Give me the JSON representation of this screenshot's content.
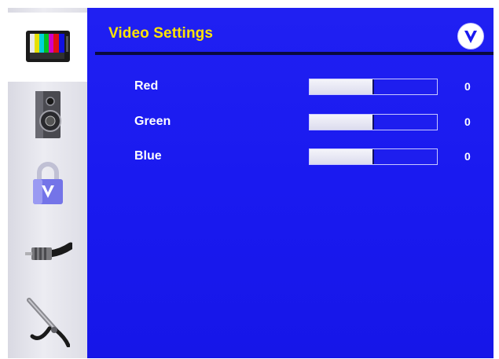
{
  "menu": {
    "title": "Video Settings",
    "accent_color": "#ffe400",
    "panel_color": "#1a1af0",
    "logo_icon": "vizio-v-logo-icon"
  },
  "sidebar": {
    "items": [
      {
        "name": "video",
        "icon": "tv-color-bars-icon",
        "active": true
      },
      {
        "name": "audio",
        "icon": "speaker-icon",
        "active": false
      },
      {
        "name": "parental-lock",
        "icon": "padlock-icon",
        "active": false
      },
      {
        "name": "cable",
        "icon": "coax-cable-icon",
        "active": false
      },
      {
        "name": "setup",
        "icon": "wrench-tool-icon",
        "active": false
      }
    ]
  },
  "settings": [
    {
      "label": "Red",
      "value": "0",
      "level": 0.5
    },
    {
      "label": "Green",
      "value": "0",
      "level": 0.5
    },
    {
      "label": "Blue",
      "value": "0",
      "level": 0.5
    }
  ]
}
